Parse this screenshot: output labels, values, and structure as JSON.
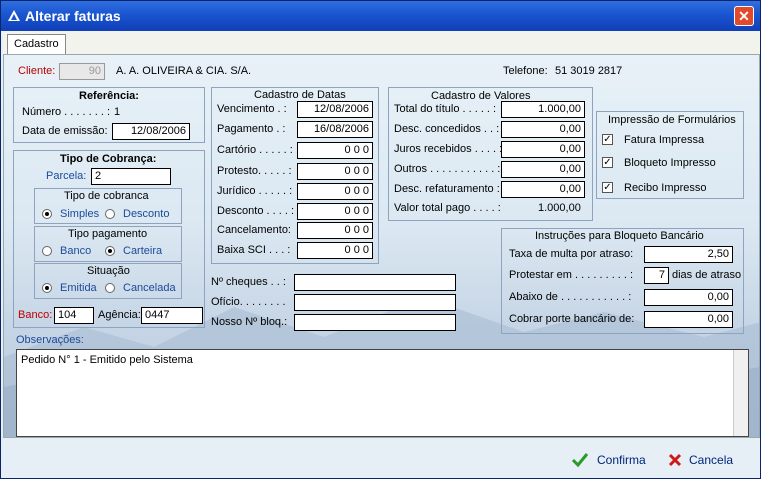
{
  "window": {
    "title": "Alterar faturas"
  },
  "tab": {
    "label": "Cadastro"
  },
  "cliente": {
    "label": "Cliente:",
    "code": "90",
    "name": "A. A. OLIVEIRA & CIA. S/A.",
    "phone_label": "Telefone:",
    "phone": "51 3019 2817"
  },
  "referencia": {
    "title": "Referência:",
    "numero_label": "Número . . . . . . . :",
    "numero": "1",
    "data_label": "Data de emissão:",
    "data": "12/08/2006"
  },
  "cobranca": {
    "title": "Tipo de Cobrança:",
    "parcela_label": "Parcela:",
    "parcela": "2",
    "tipo_title": "Tipo de cobranca",
    "tipo_options": [
      "Simples",
      "Desconto"
    ],
    "pagamento_title": "Tipo pagamento",
    "pagamento_options": [
      "Banco",
      "Carteira"
    ],
    "situacao_title": "Situação",
    "situacao_options": [
      "Emitida",
      "Cancelada"
    ],
    "banco_label": "Banco:",
    "banco": "104",
    "agencia_label": "Agência:",
    "agencia": "0447"
  },
  "datas": {
    "title": "Cadastro de Datas",
    "rows": [
      {
        "label": "Vencimento . :",
        "value": "12/08/2006"
      },
      {
        "label": "Pagamento . :",
        "value": "16/08/2006"
      },
      {
        "label": "Cartório . . . . . :",
        "value": "0 0 0"
      },
      {
        "label": "Protesto. . . . . :",
        "value": "0 0 0"
      },
      {
        "label": "Jurídico . . . . . :",
        "value": "0 0 0"
      },
      {
        "label": "Desconto . . . . :",
        "value": "0 0 0"
      },
      {
        "label": "Cancelamento:",
        "value": "0 0 0"
      },
      {
        "label": "Baixa SCI . . . :",
        "value": "0 0 0"
      }
    ]
  },
  "valores": {
    "title": "Cadastro de Valores",
    "rows": [
      {
        "label": "Total do título . . . . . :",
        "value": "1.000,00"
      },
      {
        "label": "Desc. concedidos . . :",
        "value": "0,00"
      },
      {
        "label": "Juros recebidos . . . . :",
        "value": "0,00"
      },
      {
        "label": "Outros . . . . . . . . . . . :",
        "value": "0,00"
      },
      {
        "label": "Desc. refaturamento :",
        "value": "0,00"
      }
    ],
    "total_label": "Valor total pago . . . . :",
    "total": "1.000,00"
  },
  "impressao": {
    "title": "Impressão de Formulários",
    "items": [
      "Fatura Impressa",
      "Bloqueto Impresso",
      "Recibo Impresso"
    ]
  },
  "outros": {
    "cheques_label": "Nº cheques . . :",
    "oficio_label": "Ofício. . . . . . . .",
    "nosso_label": "Nosso Nº bloq.:"
  },
  "bloqueto": {
    "title": "Instruções para Bloqueto Bancário",
    "multa_label": "Taxa de multa por atraso:",
    "multa": "2,50",
    "protestar_label": "Protestar em . . . . . . . . . :",
    "protestar": "7",
    "protestar_suffix": "dias de atraso",
    "abaixo_label": "Abaixo de . . . . . . . . . . . :",
    "abaixo": "0,00",
    "porte_label": "Cobrar porte bancário de:",
    "porte": "0,00"
  },
  "observacoes": {
    "label": "Observações:",
    "text": "Pedido N° 1 - Emitido pelo Sistema"
  },
  "buttons": {
    "confirma": "Confirma",
    "cancela": "Cancela"
  }
}
